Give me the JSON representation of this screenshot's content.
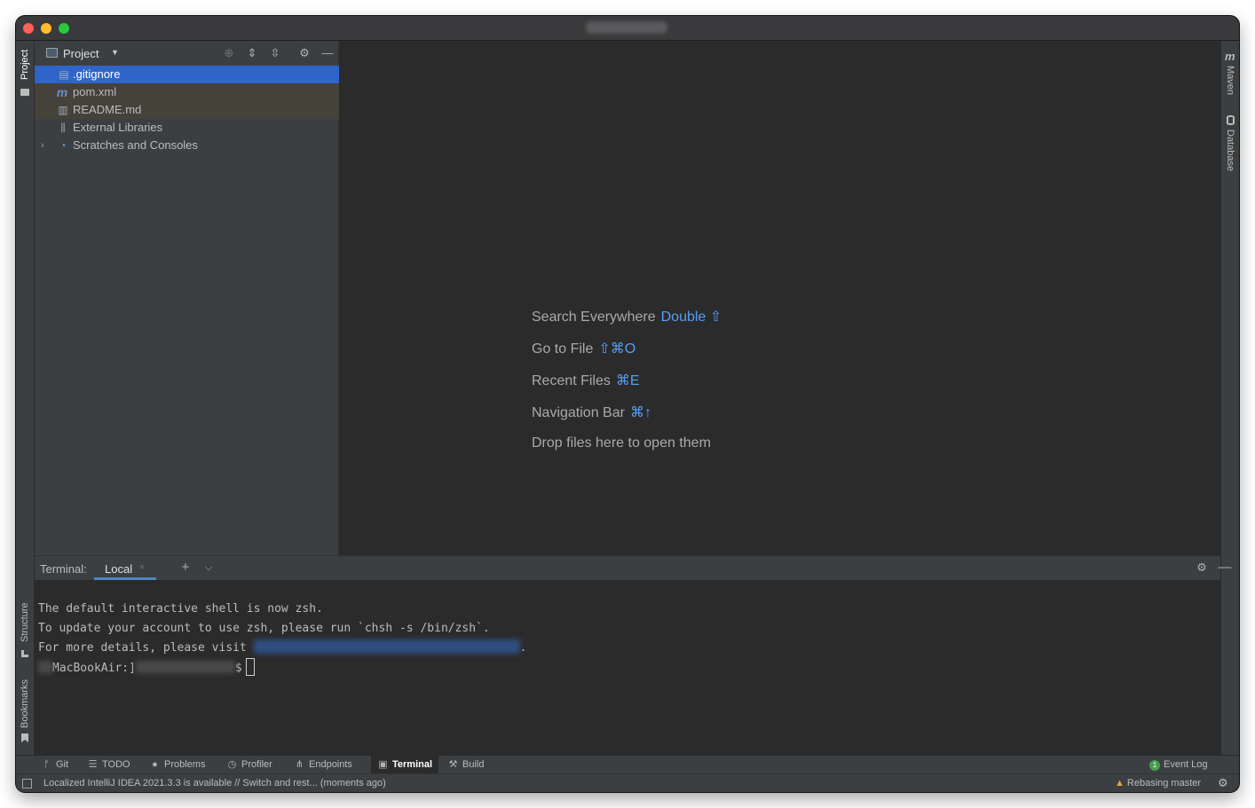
{
  "window": {
    "title": ""
  },
  "left_strip": {
    "top_tab": "Project",
    "structure_tab": "Structure",
    "bookmarks_tab": "Bookmarks"
  },
  "right_strip": {
    "maven_tab": "Maven",
    "database_tab": "Database"
  },
  "project": {
    "title": "Project",
    "items": [
      {
        "label": ".gitignore",
        "icon": "git-file-icon"
      },
      {
        "label": "pom.xml",
        "icon": "maven-icon"
      },
      {
        "label": "README.md",
        "icon": "markdown-file-icon"
      },
      {
        "label": "External Libraries",
        "icon": "libraries-icon"
      },
      {
        "label": "Scratches and Consoles",
        "icon": "scratches-icon"
      }
    ]
  },
  "editor": {
    "hints": [
      {
        "label": "Search Everywhere",
        "key": "Double ⇧"
      },
      {
        "label": "Go to File",
        "key": "⇧⌘O"
      },
      {
        "label": "Recent Files",
        "key": "⌘E"
      },
      {
        "label": "Navigation Bar",
        "key": "⌘↑"
      },
      {
        "label": "Drop files here to open them",
        "key": ""
      }
    ]
  },
  "terminal": {
    "label": "Terminal:",
    "tab": "Local",
    "lines": [
      "The default interactive shell is now zsh.",
      "To update your account to use zsh, please run `chsh -s /bin/zsh`.",
      "For more details, please visit "
    ],
    "line3_suffix": ".",
    "prompt_host": "MacBookAir:",
    "prompt_sep": "]",
    "prompt_symbol": "$"
  },
  "toolbar": {
    "items": [
      "Git",
      "TODO",
      "Problems",
      "Profiler",
      "Endpoints",
      "Terminal",
      "Build"
    ],
    "event_log": "Event Log",
    "event_log_count": "1"
  },
  "status": {
    "message": "Localized IntelliJ IDEA 2021.3.3 is available // Switch and rest... (moments ago)",
    "vcs": "Rebasing master"
  },
  "colors": {
    "selection": "#2f65ca",
    "accent": "#589df6",
    "background": "#2b2b2b",
    "panel": "#3c3f41"
  }
}
